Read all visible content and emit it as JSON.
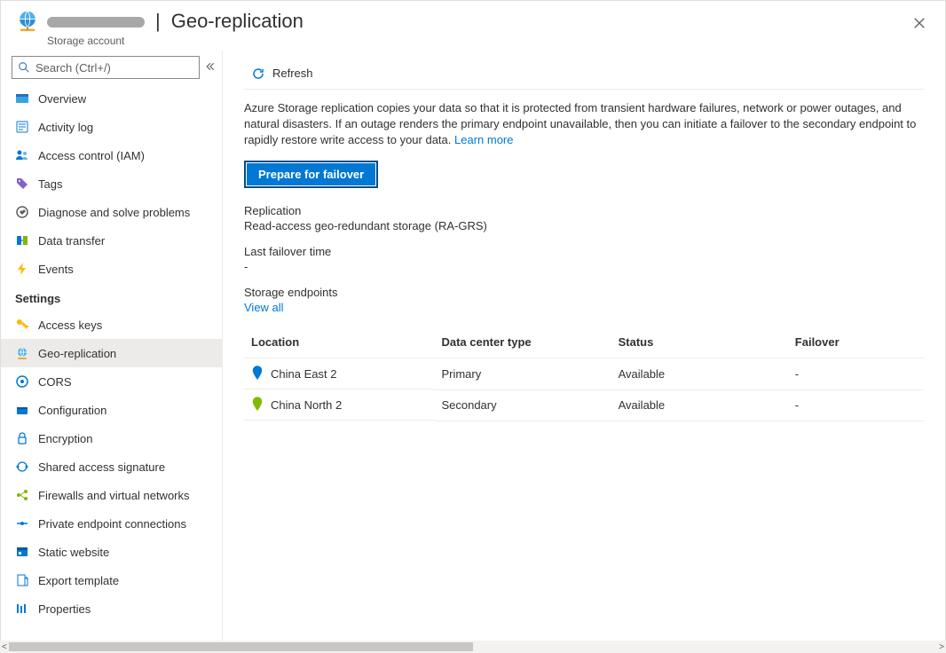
{
  "header": {
    "page_title": "Geo-replication",
    "subtitle": "Storage account",
    "close_aria": "Close"
  },
  "sidebar": {
    "search_placeholder": "Search (Ctrl+/)",
    "top_items": [
      {
        "id": "overview",
        "label": "Overview"
      },
      {
        "id": "activity-log",
        "label": "Activity log"
      },
      {
        "id": "access-control",
        "label": "Access control (IAM)"
      },
      {
        "id": "tags",
        "label": "Tags"
      },
      {
        "id": "diagnose",
        "label": "Diagnose and solve problems"
      },
      {
        "id": "data-transfer",
        "label": "Data transfer"
      },
      {
        "id": "events",
        "label": "Events"
      }
    ],
    "settings_title": "Settings",
    "settings_items": [
      {
        "id": "access-keys",
        "label": "Access keys"
      },
      {
        "id": "geo-replication",
        "label": "Geo-replication",
        "selected": true
      },
      {
        "id": "cors",
        "label": "CORS"
      },
      {
        "id": "configuration",
        "label": "Configuration"
      },
      {
        "id": "encryption",
        "label": "Encryption"
      },
      {
        "id": "sas",
        "label": "Shared access signature"
      },
      {
        "id": "firewalls",
        "label": "Firewalls and virtual networks"
      },
      {
        "id": "private-endpoint",
        "label": "Private endpoint connections"
      },
      {
        "id": "static-website",
        "label": "Static website"
      },
      {
        "id": "export-template",
        "label": "Export template"
      },
      {
        "id": "properties",
        "label": "Properties"
      }
    ]
  },
  "toolbar": {
    "refresh": "Refresh"
  },
  "main": {
    "intro_text": "Azure Storage replication copies your data so that it is protected from transient hardware failures, network or power outages, and natural disasters. If an outage renders the primary endpoint unavailable, then you can initiate a failover to the secondary endpoint to rapidly restore write access to your data. ",
    "learn_more": "Learn more",
    "prepare_btn": "Prepare for failover",
    "replication_label": "Replication",
    "replication_value": "Read-access geo-redundant storage (RA-GRS)",
    "last_failover_label": "Last failover time",
    "last_failover_value": "-",
    "storage_endpoints_label": "Storage endpoints",
    "view_all": "View all",
    "table": {
      "headers": {
        "location": "Location",
        "dctype": "Data center type",
        "status": "Status",
        "failover": "Failover"
      },
      "rows": [
        {
          "pin_color": "#0078d4",
          "location": "China East 2",
          "dctype": "Primary",
          "status": "Available",
          "failover": "-"
        },
        {
          "pin_color": "#7fba00",
          "location": "China North 2",
          "dctype": "Secondary",
          "status": "Available",
          "failover": "-"
        }
      ]
    }
  }
}
